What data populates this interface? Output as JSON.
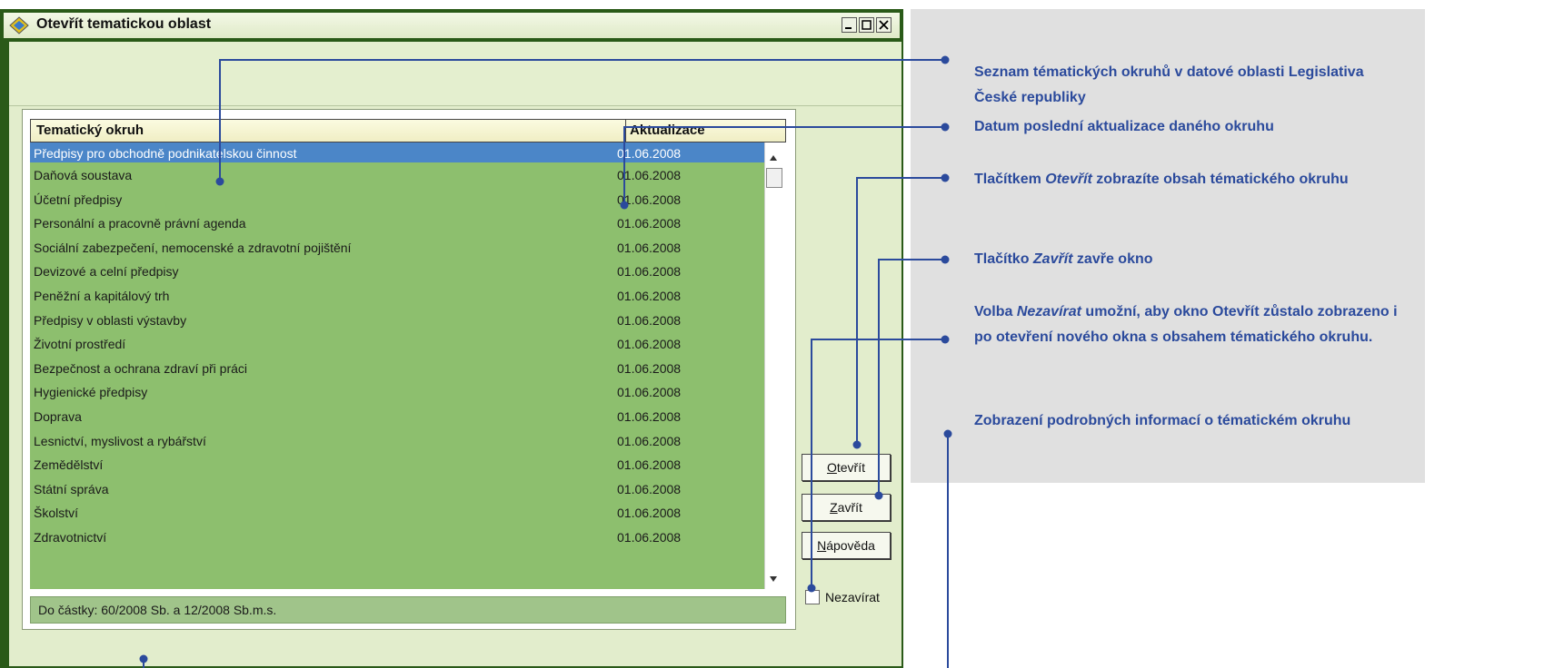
{
  "window": {
    "title": "Otevřít tematickou oblast",
    "colors": {
      "list_bg": "#8dbf6e",
      "selection": "#4b86c8",
      "frame": "#2a5a18"
    }
  },
  "list": {
    "columns": {
      "topic": "Tematický okruh",
      "updated": "Aktualizace"
    },
    "rows": [
      {
        "topic": "Předpisy pro obchodně podnikatelskou činnost",
        "date": "01.06.2008",
        "selected": true
      },
      {
        "topic": "Daňová soustava",
        "date": "01.06.2008"
      },
      {
        "topic": "Účetní předpisy",
        "date": "01.06.2008"
      },
      {
        "topic": "Personální a pracovně právní agenda",
        "date": "01.06.2008"
      },
      {
        "topic": "Sociální zabezpečení, nemocenské a zdravotní pojištění",
        "date": "01.06.2008"
      },
      {
        "topic": "Devizové a celní předpisy",
        "date": "01.06.2008"
      },
      {
        "topic": "Peněžní a kapitálový trh",
        "date": "01.06.2008"
      },
      {
        "topic": "Předpisy v oblasti výstavby",
        "date": "01.06.2008"
      },
      {
        "topic": "Životní prostředí",
        "date": "01.06.2008"
      },
      {
        "topic": "Bezpečnost a ochrana zdraví při práci",
        "date": "01.06.2008"
      },
      {
        "topic": "Hygienické předpisy",
        "date": "01.06.2008"
      },
      {
        "topic": "Doprava",
        "date": "01.06.2008"
      },
      {
        "topic": "Lesnictví, myslivost a rybářství",
        "date": "01.06.2008"
      },
      {
        "topic": "Zemědělství",
        "date": "01.06.2008"
      },
      {
        "topic": "Státní správa",
        "date": "01.06.2008"
      },
      {
        "topic": "Školství",
        "date": "01.06.2008"
      },
      {
        "topic": "Zdravotnictví",
        "date": "01.06.2008"
      }
    ],
    "status": "Do částky: 60/2008 Sb. a 12/2008 Sb.m.s."
  },
  "buttons": {
    "open": {
      "accel": "O",
      "rest": "tevřít"
    },
    "close": {
      "accel": "Z",
      "rest": "avřít"
    },
    "help": {
      "accel": "N",
      "rest": "ápověda"
    }
  },
  "keep_open_label": "Nezavírat",
  "notes": {
    "n1": "Seznam tématických okruhů v datové oblasti Legislativa České republiky",
    "n2": "Datum poslední aktualizace daného okruhu",
    "n3_pre": "Tlačítkem ",
    "n3_em": "Otevřít",
    "n3_post": " zobrazíte obsah tématického okruhu",
    "n4_pre": "Tlačítko ",
    "n4_em": "Zavřít",
    "n4_post": " zavře okno",
    "n5_pre": "Volba ",
    "n5_em": "Nezavírat",
    "n5_post": " umožní, aby okno Otevřít zůstalo zobrazeno i po otevření nového okna s obsahem tématického okruhu.",
    "n6": "Zobrazení podrobných informací o tématickém okruhu"
  },
  "annotation_color": "#2b4a9c"
}
